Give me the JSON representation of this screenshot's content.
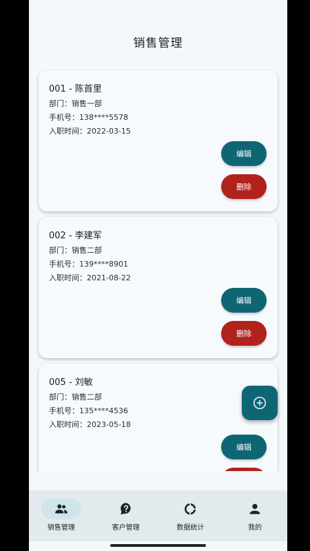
{
  "header": {
    "title": "销售管理"
  },
  "employees": [
    {
      "title": "001 - 陈首里",
      "dept": "部门：销售一部",
      "phone": "手机号：138****5578",
      "hired": "入职时间：2022-03-15"
    },
    {
      "title": "002 - 李建军",
      "dept": "部门：销售二部",
      "phone": "手机号：139****8901",
      "hired": "入职时间：2021-08-22"
    },
    {
      "title": "005 - 刘敏",
      "dept": "部门：销售二部",
      "phone": "手机号：135****4536",
      "hired": "入职时间：2023-05-18"
    }
  ],
  "actions": {
    "edit_label": "编辑",
    "delete_label": "删除"
  },
  "fab": {
    "icon": "add-circle-icon"
  },
  "nav": {
    "items": [
      {
        "label": "销售管理",
        "icon": "people-icon",
        "active": true
      },
      {
        "label": "客户管理",
        "icon": "help-bubble-icon",
        "active": false
      },
      {
        "label": "数据统计",
        "icon": "donut-icon",
        "active": false
      },
      {
        "label": "我的",
        "icon": "person-icon",
        "active": false
      }
    ]
  },
  "colors": {
    "primary": "#0e6674",
    "danger": "#b2221d",
    "background": "#f4f8fa",
    "nav_background": "#e3eaee",
    "nav_active": "#cfe5ec"
  }
}
